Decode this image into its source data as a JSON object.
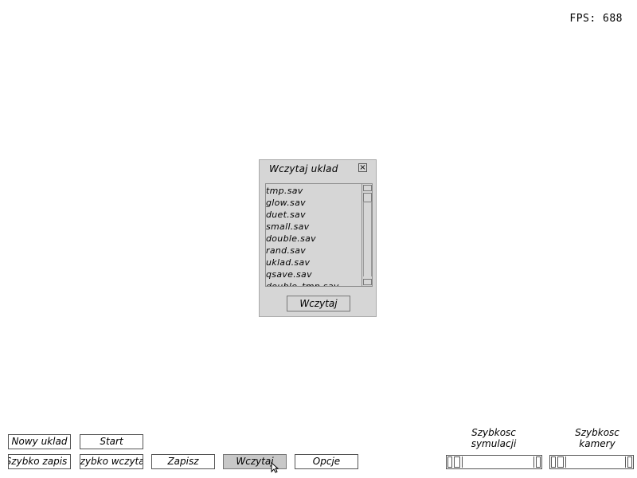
{
  "fps": {
    "text": "FPS: 688"
  },
  "dialog": {
    "title": "Wczytaj uklad",
    "files": [
      "tmp.sav",
      "glow.sav",
      "duet.sav",
      "small.sav",
      "double.sav",
      "rand.sav",
      "uklad.sav",
      "qsave.sav",
      "double_tmp.sav"
    ],
    "load_button": "Wczytaj"
  },
  "toolbar": {
    "row1": {
      "new_layout": "Nowy uklad",
      "start": "Start"
    },
    "row2": {
      "quick_save": "Szybko zapis",
      "quick_load": "Szybko wczyta",
      "save": "Zapisz",
      "load": "Wczytaj",
      "options": "Opcje"
    }
  },
  "sliders": {
    "simulation_speed": {
      "label": "Szybkosc\nsymulacji"
    },
    "camera_speed": {
      "label": "Szybkosc\nkamery"
    }
  }
}
